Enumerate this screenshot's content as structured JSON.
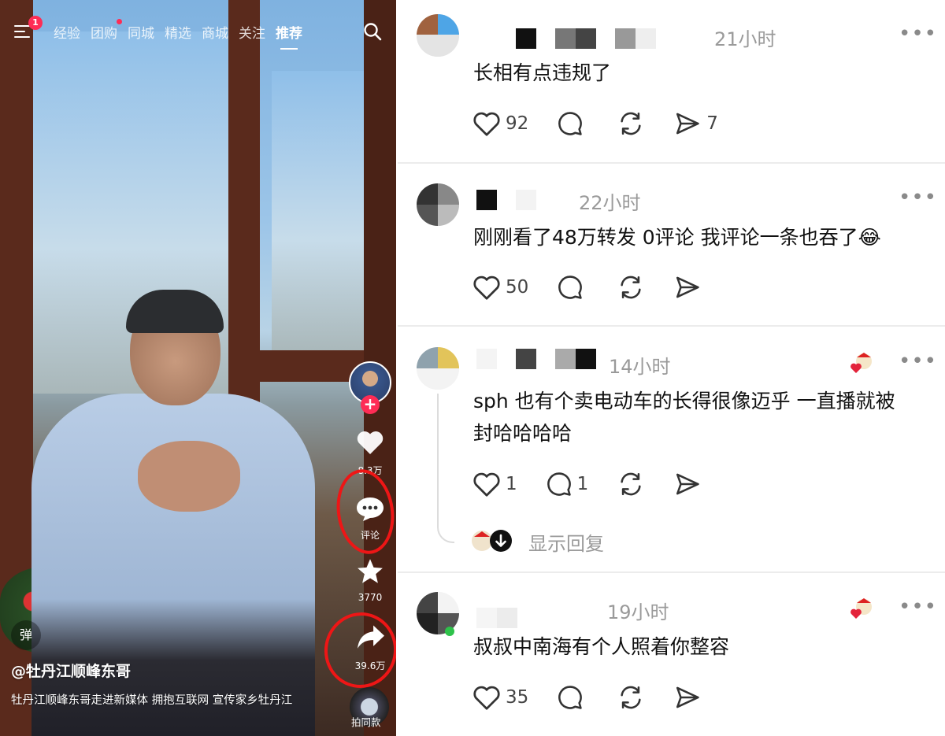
{
  "video": {
    "nav": {
      "menu_badge": "1",
      "tabs": [
        "经验",
        "团购",
        "同城",
        "精选",
        "商城",
        "关注",
        "推荐"
      ],
      "active_tab": "推荐"
    },
    "side": {
      "like_count": "8.3万",
      "comment_label": "评论",
      "favorite_count": "3770",
      "share_count": "39.6万",
      "music_label": "拍同款"
    },
    "danmu_label": "弹",
    "author": "@牡丹江顺峰东哥",
    "description": "牡丹江顺峰东哥走进新媒体 拥抱互联网 宣传家乡牡丹江"
  },
  "comments": [
    {
      "time": "21小时",
      "text": "长相有点违规了",
      "likes": "92",
      "replies": "",
      "shares": "7"
    },
    {
      "time": "22小时",
      "text": "刚刚看了48万转发 0评论 我评论一条也吞了😂",
      "likes": "50",
      "replies": "",
      "shares": ""
    },
    {
      "time": "14小时",
      "text_line1": "sph 也有个卖电动车的长得很像迈乎 一直播就被",
      "text_line2": "封哈哈哈哈",
      "likes": "1",
      "replies": "1",
      "shares": "",
      "show_replies": "显示回复"
    },
    {
      "time": "19小时",
      "text": "叔叔中南海有个人照着你整容",
      "likes": "35",
      "replies": "",
      "shares": ""
    }
  ],
  "more_glyph": "•••",
  "colors": {
    "accent": "#fe2c55",
    "annotation_red": "#ee1616",
    "muted": "#9a9a9a"
  },
  "icons": [
    "menu-icon",
    "search-icon",
    "heart-icon",
    "comment-icon",
    "star-icon",
    "share-icon",
    "repost-icon",
    "send-icon",
    "more-icon"
  ]
}
